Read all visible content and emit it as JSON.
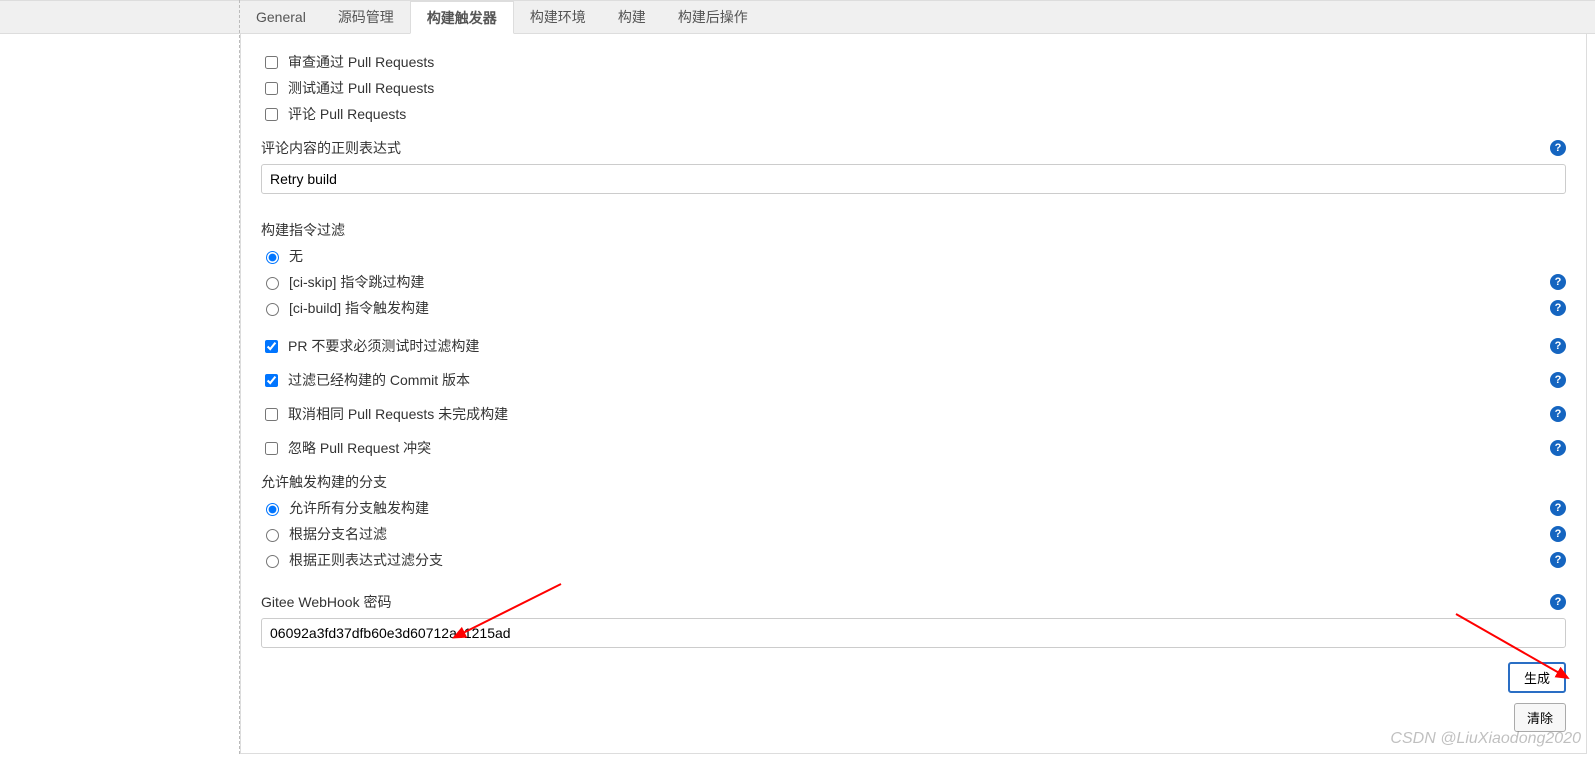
{
  "tabs": {
    "general": "General",
    "scm": "源码管理",
    "triggers": "构建触发器",
    "env": "构建环境",
    "build": "构建",
    "postbuild": "构建后操作"
  },
  "checkboxes": {
    "approvePR": "审查通过 Pull Requests",
    "testPR": "测试通过 Pull Requests",
    "commentPR": "评论 Pull Requests"
  },
  "commentRegex": {
    "label": "评论内容的正则表达式",
    "value": "Retry build"
  },
  "buildCmdFilter": {
    "title": "构建指令过滤",
    "none": "无",
    "ciskip": "[ci-skip] 指令跳过构建",
    "cibuild": "[ci-build] 指令触发构建"
  },
  "prNoTest": "PR 不要求必须测试时过滤构建",
  "filterBuiltCommit": "过滤已经构建的 Commit 版本",
  "cancelUnfinishedPR": "取消相同 Pull Requests 未完成构建",
  "ignorePRConflict": "忽略 Pull Request 冲突",
  "branchFilter": {
    "title": "允许触发构建的分支",
    "all": "允许所有分支触发构建",
    "byName": "根据分支名过滤",
    "byRegex": "根据正则表达式过滤分支"
  },
  "webhook": {
    "label": "Gitee WebHook 密码",
    "value": "06092a3fd37dfb60e3d60712ac1215ad"
  },
  "buttons": {
    "generate": "生成",
    "clear": "清除"
  },
  "watermark": "CSDN @LiuXiaodong2020"
}
